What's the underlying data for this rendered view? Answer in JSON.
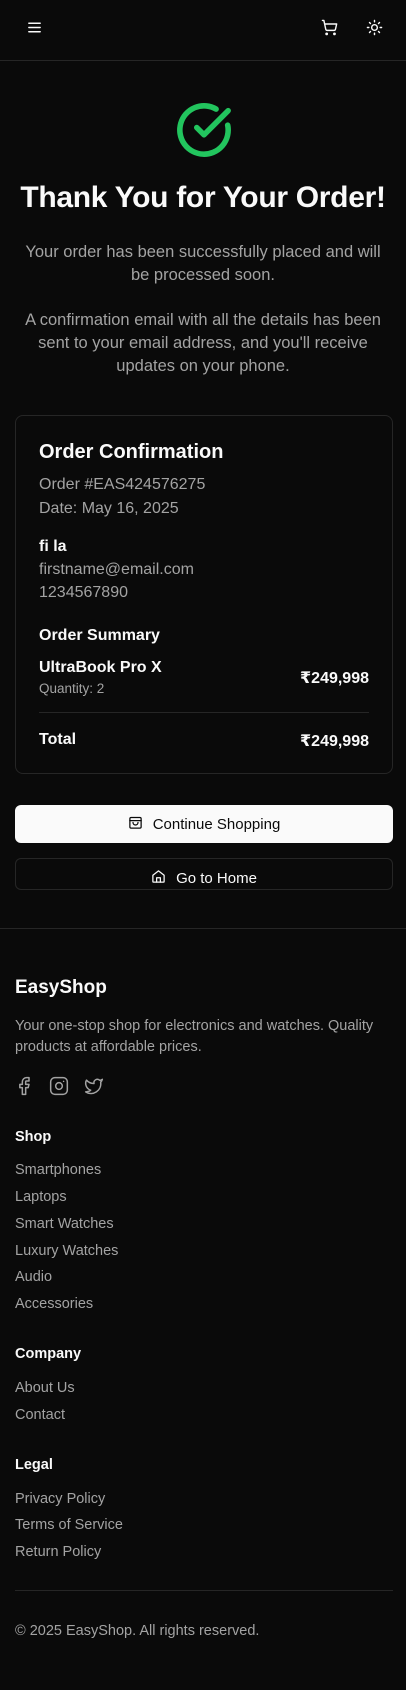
{
  "header": {
    "menu_icon": "menu-icon",
    "cart_icon": "shopping-cart-icon",
    "theme_icon": "sun-icon"
  },
  "hero": {
    "icon": "check-circle-icon",
    "title": "Thank You for Your Order!",
    "message": "Your order has been successfully placed and will be processed soon.",
    "email_note": "A confirmation email with all the details has been sent to your email address, and you'll receive updates on your phone."
  },
  "order": {
    "heading": "Order Confirmation",
    "number": "Order #EAS424576275",
    "date": "Date: May 16, 2025",
    "customer_name": "fi la",
    "customer_email": "firstname@email.com",
    "customer_phone": "1234567890",
    "summary_heading": "Order Summary",
    "items": [
      {
        "name": "UltraBook Pro X",
        "quantity": "Quantity: 2",
        "price": "₹249,998"
      }
    ],
    "total_label": "Total",
    "total_value": "₹249,998"
  },
  "actions": {
    "continue_label": "Continue Shopping",
    "continue_icon": "shopping-bag-icon",
    "home_label": "Go to Home",
    "home_icon": "home-icon"
  },
  "footer": {
    "brand": "EasyShop",
    "description": "Your one-stop shop for electronics and watches. Quality products at affordable prices.",
    "social_icons": [
      "facebook-icon",
      "instagram-icon",
      "twitter-icon"
    ],
    "shop_heading": "Shop",
    "shop_links": [
      "Smartphones",
      "Laptops",
      "Smart Watches",
      "Luxury Watches",
      "Audio",
      "Accessories"
    ],
    "company_heading": "Company",
    "company_links": [
      "About Us",
      "Contact"
    ],
    "legal_heading": "Legal",
    "legal_links": [
      "Privacy Policy",
      "Terms of Service",
      "Return Policy"
    ],
    "copyright": "© 2025 EasyShop. All rights reserved."
  },
  "colors": {
    "background": "#0a0a0a",
    "foreground": "#fafafa",
    "muted": "#a3a3a3",
    "border": "#262626",
    "success": "#22c55e"
  }
}
